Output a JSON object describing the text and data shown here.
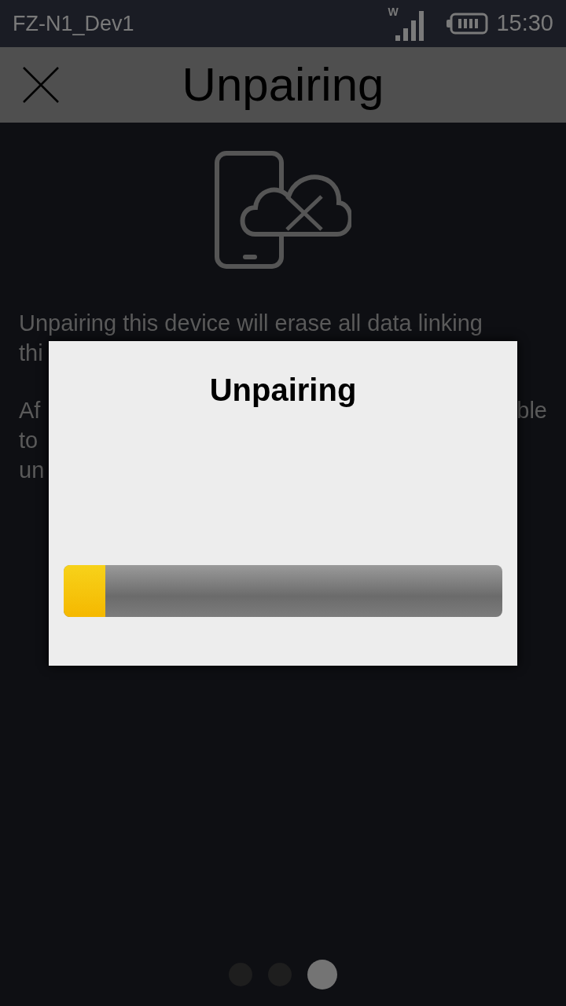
{
  "status_bar": {
    "carrier": "FZ-N1_Dev1",
    "network_type": "W",
    "time": "15:30"
  },
  "header": {
    "title": "Unpairing"
  },
  "background_text": {
    "paragraphs": [
      {
        "lines": [
          {
            "left": "Unpairing this device will erase all data linking"
          },
          {
            "left": "thi"
          }
        ]
      },
      {
        "lines": [
          {
            "left": "Af",
            "right": "ble"
          },
          {
            "left": "to"
          },
          {
            "left": "un"
          }
        ]
      }
    ]
  },
  "dialog": {
    "title": "Unpairing",
    "progress": {
      "level": 0.095
    }
  },
  "page_dots": [
    {
      "selected": false
    },
    {
      "selected": false
    },
    {
      "selected": true
    }
  ]
}
